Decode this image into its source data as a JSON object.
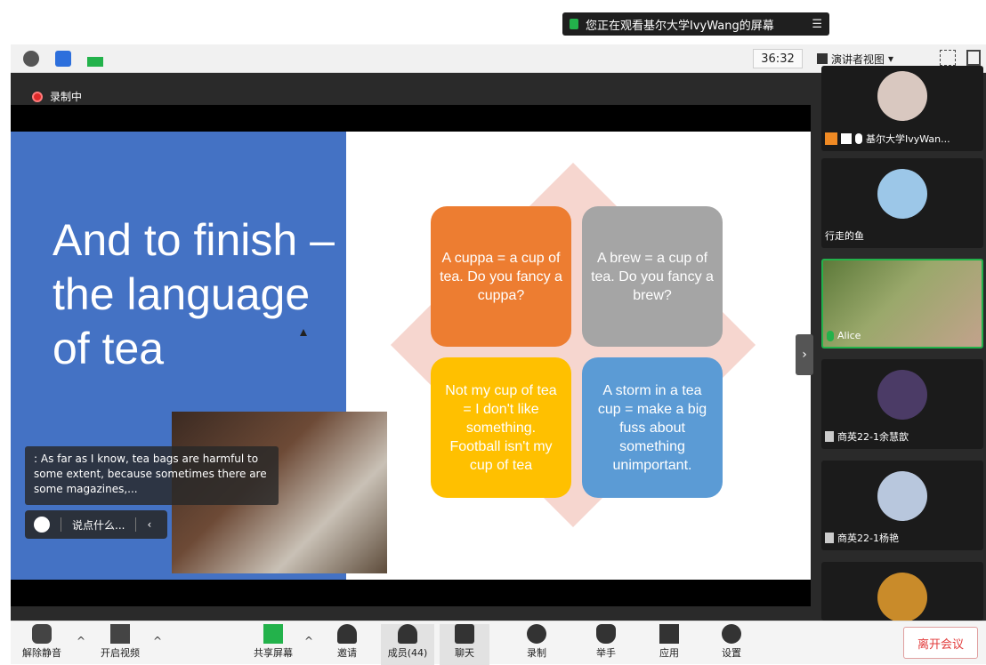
{
  "banner": {
    "text": "您正在观看基尔大学IvyWang的屏幕",
    "menu": "☰"
  },
  "toolbar": {
    "timer": "36:32",
    "view_label": "演讲者视图",
    "view_caret": "▾"
  },
  "recording": {
    "label": "录制中"
  },
  "slide": {
    "title": "And to finish – the language of tea",
    "boxes": [
      {
        "text": "A cuppa = a cup of tea. Do you fancy a cuppa?",
        "color": "#ed7d31"
      },
      {
        "text": "A brew = a cup of tea. Do you fancy a brew?",
        "color": "#a5a5a5"
      },
      {
        "text": "Not my cup of tea = I don't like something. Football isn't my cup of tea",
        "color": "#ffc000"
      },
      {
        "text": "A storm in a tea cup = make a big fuss about something unimportant.",
        "color": "#5b9bd5"
      }
    ]
  },
  "chat": {
    "message": ": As far as I know, tea bags are harmful to some extent, because sometimes there are some magazines,...",
    "input_placeholder": "说点什么...",
    "back": "‹"
  },
  "participants": [
    {
      "name": "基尔大学IvyWan...",
      "pic_color": "#d9c8c0"
    },
    {
      "name": "行走的鱼",
      "pic_color": "#9cc7e8"
    },
    {
      "name": "Alice",
      "pic_color": "#7a8f4e"
    },
    {
      "name": "商英22-1余慧歆",
      "pic_color": "#4b3b66"
    },
    {
      "name": "商英22-1杨艳",
      "pic_color": "#b8c7dd"
    }
  ],
  "controls": {
    "unmute": "解除静音",
    "video": "开启视频",
    "share": "共享屏幕",
    "invite": "邀请",
    "members": "成员(44)",
    "chat": "聊天",
    "record": "录制",
    "raise_hand": "举手",
    "apps": "应用",
    "settings": "设置",
    "leave": "离开会议"
  },
  "colors": {
    "accent_green": "#23b24b",
    "record_red": "#e02a2a",
    "leave_red": "#e23b3b"
  }
}
